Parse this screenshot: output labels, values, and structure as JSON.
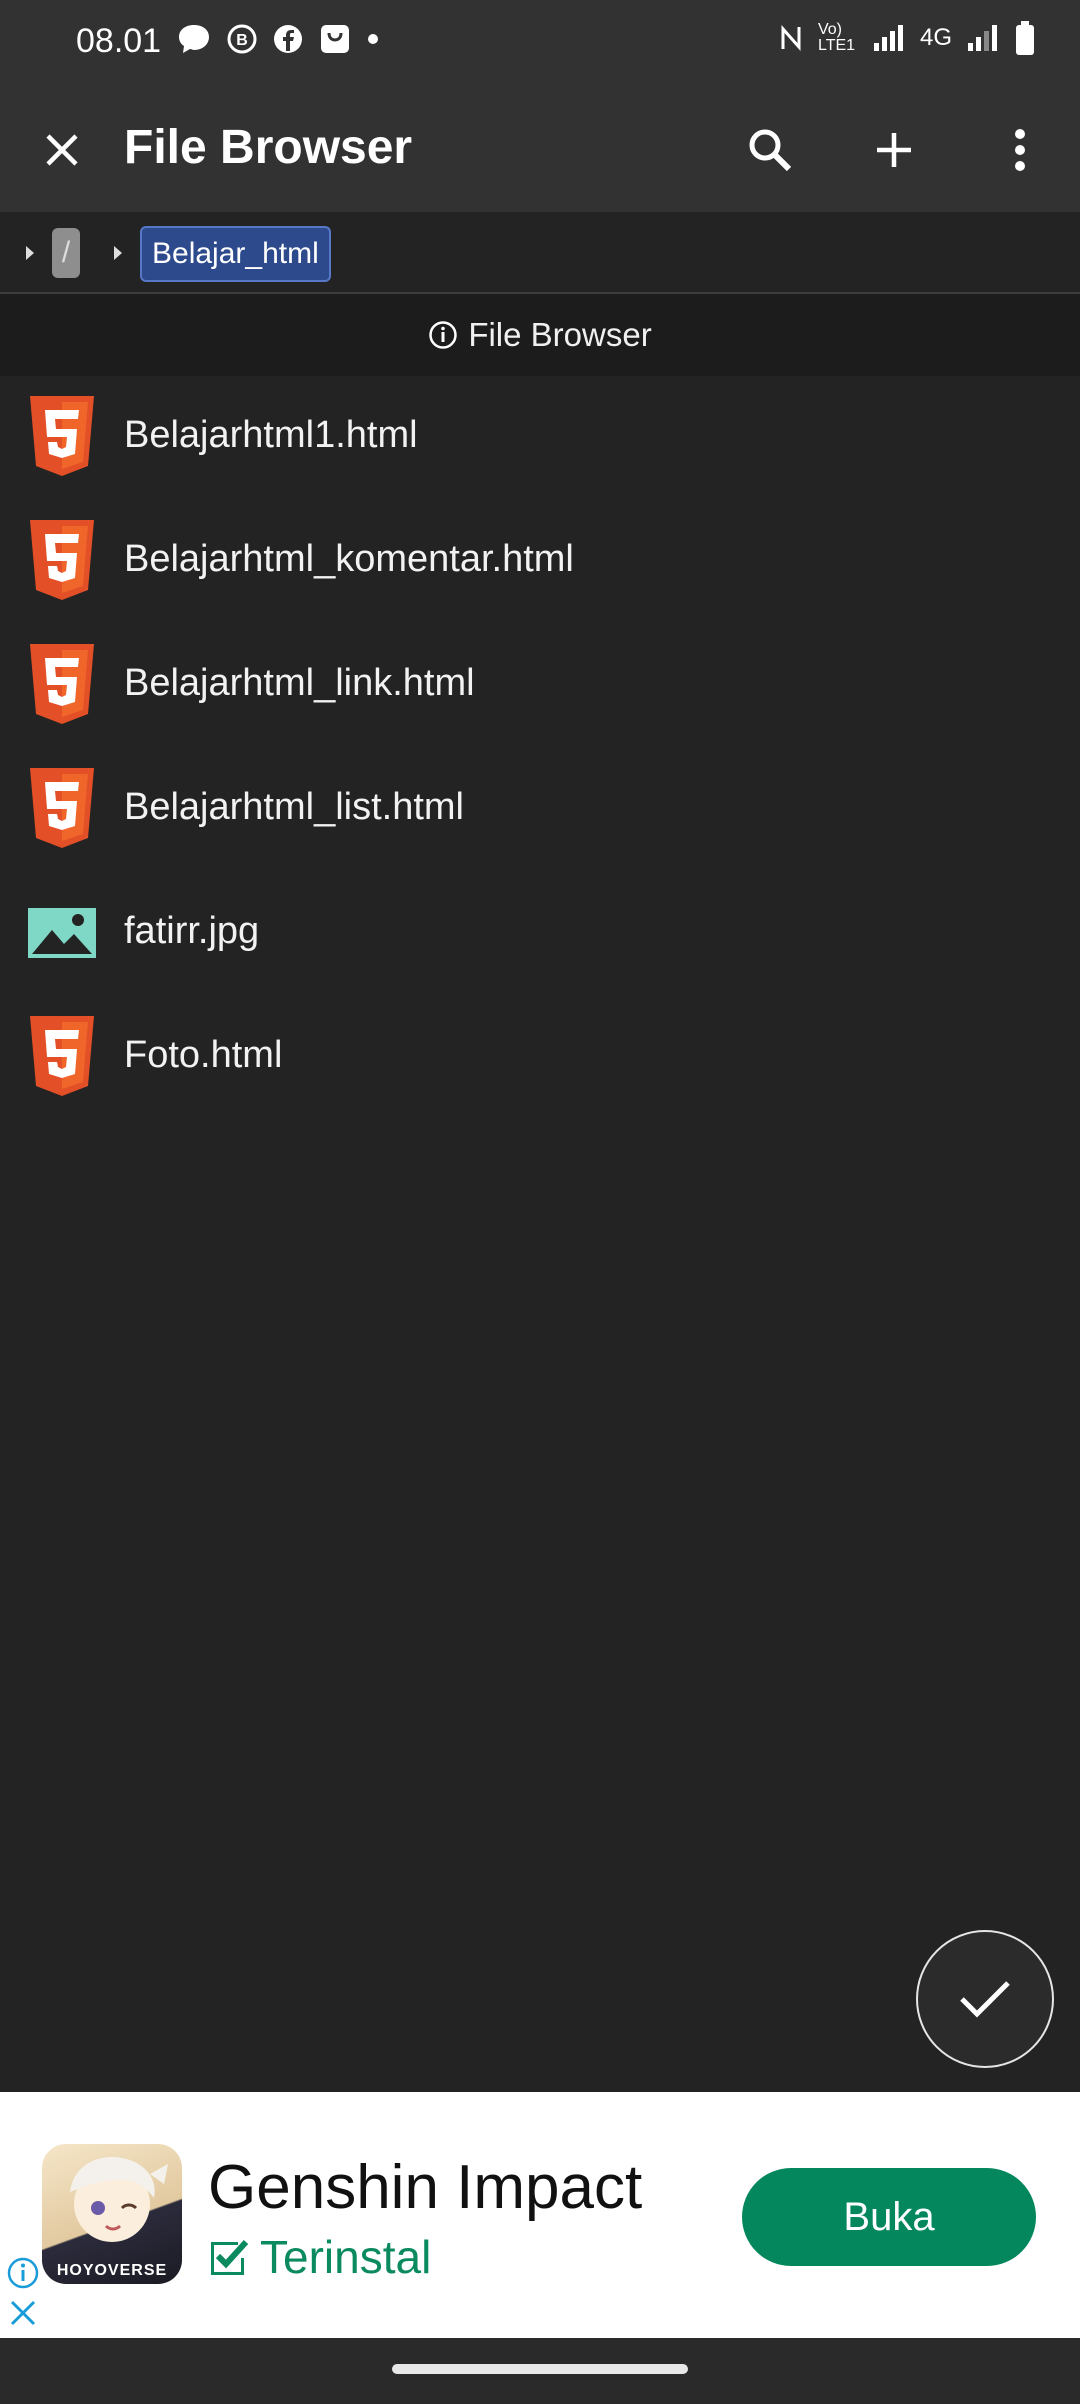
{
  "status_bar": {
    "time": "08.01",
    "network_label": "4G",
    "volte_label": "Vo) LTE1"
  },
  "app_bar": {
    "title": "File Browser",
    "close_icon": "close-icon",
    "search_icon": "search-icon",
    "add_icon": "plus-icon",
    "menu_icon": "more-vert-icon"
  },
  "breadcrumb": {
    "root": "/",
    "current": "Belajar_html"
  },
  "info_bar": {
    "label": "File Browser"
  },
  "files": [
    {
      "name": "Belajarhtml1.html",
      "icon": "html5-icon"
    },
    {
      "name": "Belajarhtml_komentar.html",
      "icon": "html5-icon"
    },
    {
      "name": "Belajarhtml_link.html",
      "icon": "html5-icon"
    },
    {
      "name": "Belajarhtml_list.html",
      "icon": "html5-icon"
    },
    {
      "name": "fatirr.jpg",
      "icon": "image-icon"
    },
    {
      "name": "Foto.html",
      "icon": "html5-icon"
    }
  ],
  "ad": {
    "app_name": "Genshin Impact",
    "installed_label": "Terinstal",
    "open_button": "Buka",
    "brand": "HOYOVERSE"
  },
  "colors": {
    "background": "#232323",
    "appbar": "#323232",
    "html5": "#e34f26",
    "image_icon": "#7fd8c6",
    "accent_green": "#05875e",
    "crumb_highlight": "#2c4a8c"
  }
}
